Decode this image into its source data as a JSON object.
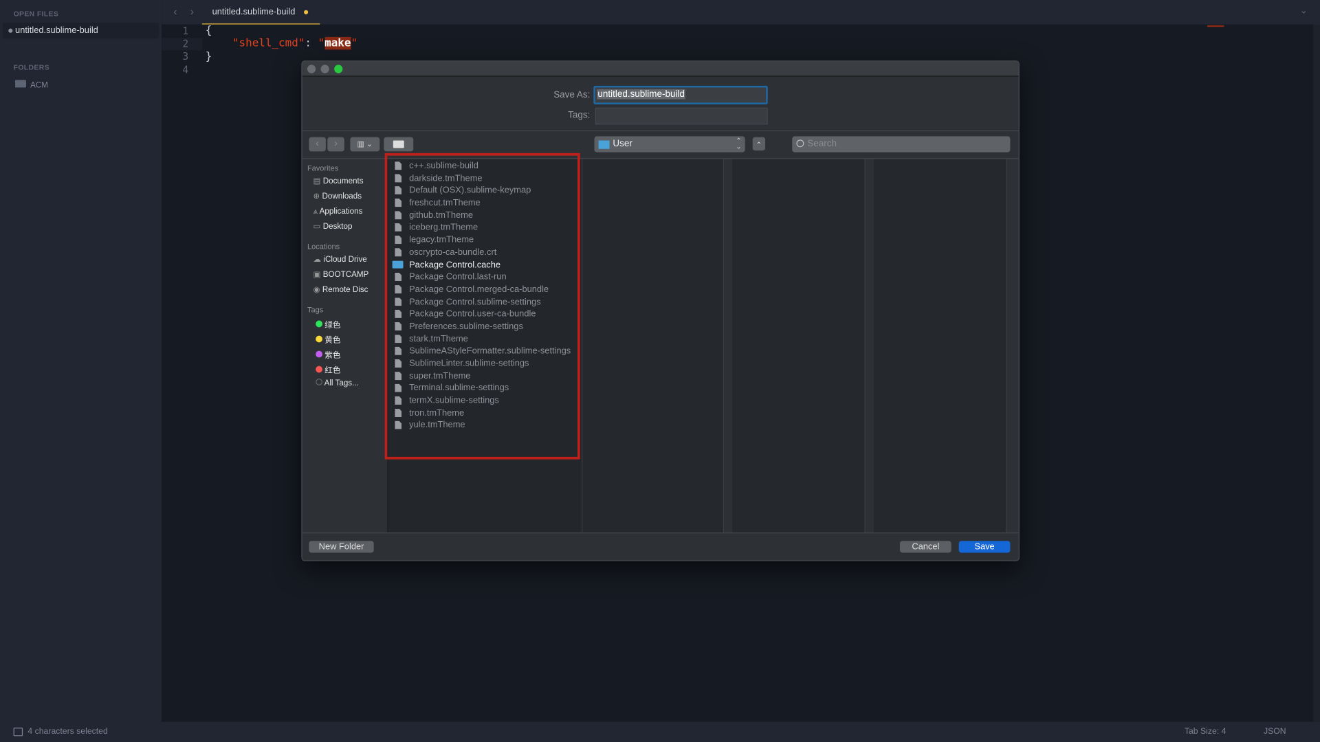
{
  "sidebar": {
    "open_files_heading": "OPEN FILES",
    "open_file": "untitled.sublime-build",
    "folders_heading": "FOLDERS",
    "folder": "ACM"
  },
  "tab": {
    "title": "untitled.sublime-build",
    "modified_color": "#f0c040"
  },
  "editor": {
    "line_numbers": [
      "1",
      "2",
      "3",
      "4"
    ],
    "lines": {
      "l1": "{",
      "key": "\"shell_cmd\"",
      "colon": ": ",
      "q1": "\"",
      "value": "make",
      "q2": "\"",
      "l3": "}"
    }
  },
  "status": {
    "selection": "4 characters selected",
    "tab_size": "Tab Size: 4",
    "syntax": "JSON"
  },
  "dialog": {
    "save_as_label": "Save As:",
    "save_as_value": "untitled.sublime-build",
    "tags_label": "Tags:",
    "tags_value": "",
    "location": "User",
    "search_placeholder": "Search",
    "favorites_heading": "Favorites",
    "favorites": [
      "Documents",
      "Downloads",
      "Applications",
      "Desktop"
    ],
    "locations_heading": "Locations",
    "locations": [
      "iCloud Drive",
      "BOOTCAMP",
      "Remote Disc"
    ],
    "tags_heading": "Tags",
    "tags": [
      {
        "label": "绿色",
        "color": "#2ee65b"
      },
      {
        "label": "黄色",
        "color": "#fcd93a"
      },
      {
        "label": "紫色",
        "color": "#c45cf0"
      },
      {
        "label": "红色",
        "color": "#fb5656"
      },
      {
        "label": "All Tags...",
        "color": ""
      }
    ],
    "files": [
      "c++.sublime-build",
      "darkside.tmTheme",
      "Default (OSX).sublime-keymap",
      "freshcut.tmTheme",
      "github.tmTheme",
      "iceberg.tmTheme",
      "legacy.tmTheme",
      "oscrypto-ca-bundle.crt",
      "Package Control.cache",
      "Package Control.last-run",
      "Package Control.merged-ca-bundle",
      "Package Control.sublime-settings",
      "Package Control.user-ca-bundle",
      "Preferences.sublime-settings",
      "stark.tmTheme",
      "SublimeAStyleFormatter.sublime-settings",
      "SublimeLinter.sublime-settings",
      "super.tmTheme",
      "Terminal.sublime-settings",
      "termX.sublime-settings",
      "tron.tmTheme",
      "yule.tmTheme"
    ],
    "folder_items": [
      "Package Control.cache"
    ],
    "new_folder": "New Folder",
    "cancel": "Cancel",
    "save": "Save",
    "highlight_color": "#c0201a"
  }
}
